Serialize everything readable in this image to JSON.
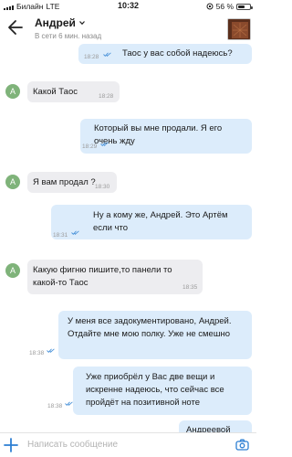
{
  "status_bar": {
    "carrier": "Билайн",
    "network": "LTE",
    "time": "10:32",
    "battery": "56 %",
    "battery_level": 0.56
  },
  "header": {
    "name": "Андрей",
    "status": "В сети 6 мин. назад"
  },
  "messages": [
    {
      "text": "Таос у вас собой надеюсь?",
      "time": "18:28"
    },
    {
      "text": "Какой Таос",
      "time": "18:28",
      "avatar": "A"
    },
    {
      "text": "Который вы мне продали. Я его очень жду",
      "time": "18:29"
    },
    {
      "text": "Я вам продал ?",
      "time": "18:30",
      "avatar": "A"
    },
    {
      "text": "Ну а кому же, Андрей. Это Артём если что",
      "time": "18:31"
    },
    {
      "text": "Какую фигню пишите,то панели то какой-то Таос",
      "time": "18:35",
      "avatar": "A"
    },
    {
      "text": "У меня все задокументировано, Андрей. Отдайте мне мою полку. Уже не смешно",
      "time": "18:38"
    },
    {
      "text": "Уже приобрёл у Вас две вещи и искренне надеюсь, что сейчас все пройдёт на позитивной ноте",
      "time": "18:38"
    },
    {
      "text": "Андреевой"
    }
  ],
  "input": {
    "placeholder": "Написать сообщение"
  },
  "colors": {
    "accent": "#2d7fd3",
    "incoming_bubble": "#ededf0",
    "outgoing_bubble": "#dcecfb",
    "avatar": "#7fb37a"
  },
  "icons": {
    "back": "back-arrow-icon",
    "plus": "plus-icon",
    "camera": "camera-icon",
    "read": "double-check-icon"
  }
}
